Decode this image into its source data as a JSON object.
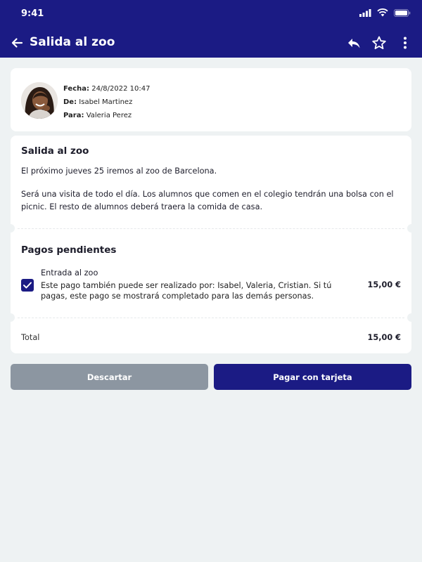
{
  "status_bar": {
    "time": "9:41"
  },
  "app_bar": {
    "title": "Salida al zoo",
    "actions": [
      "reply-icon",
      "star-icon",
      "more-vert-icon"
    ]
  },
  "header": {
    "fecha_label": "Fecha:",
    "fecha_value": "24/8/2022 10:47",
    "de_label": "De:",
    "de_value": "Isabel Martinez",
    "para_label": "Para:",
    "para_value": "Valeria Perez"
  },
  "message": {
    "title": "Salida al zoo",
    "paragraph1": "El próximo jueves 25 iremos al zoo de Barcelona.",
    "paragraph2": "Será una visita de todo el día. Los alumnos que comen en el colegio tendrán una bolsa con el picnic. El resto de alumnos deberá traera la comida de casa."
  },
  "payments": {
    "title": "Pagos pendientes",
    "item": {
      "name": "Entrada al zoo",
      "description": "Este pago también puede ser realizado por: Isabel, Valeria, Cristian. Si tú pagas, este pago se mostrará completado para las demás personas.",
      "price": "15,00 €",
      "checked": true
    },
    "total_label": "Total",
    "total_value": "15,00 €"
  },
  "buttons": {
    "discard": "Descartar",
    "pay": "Pagar con tarjeta"
  },
  "colors": {
    "primary": "#1b1b84",
    "background": "#eef2f3",
    "discard": "#8c96a1"
  }
}
